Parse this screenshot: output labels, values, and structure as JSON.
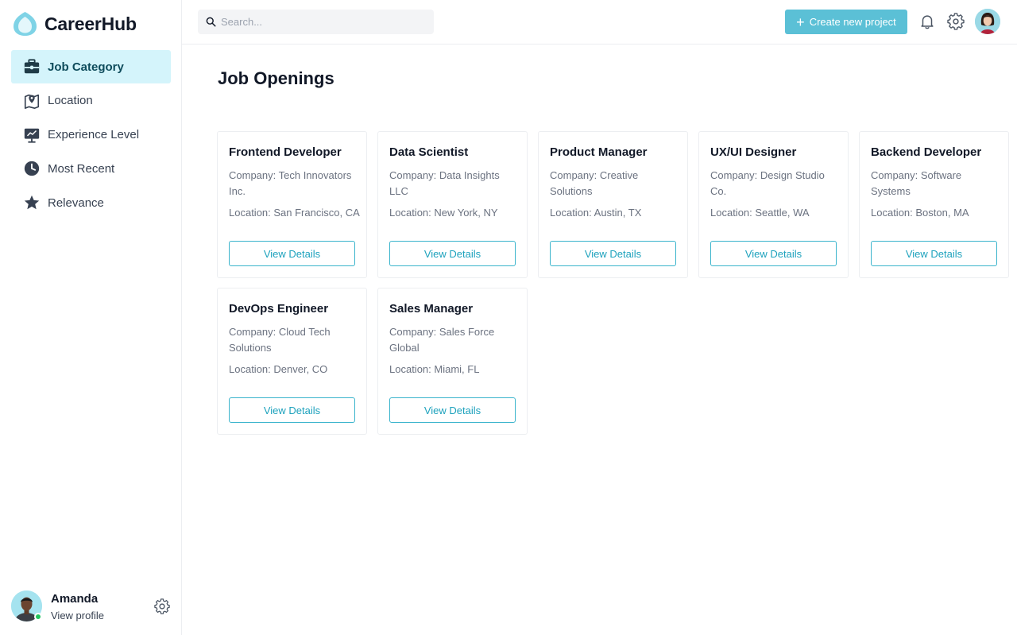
{
  "brand": {
    "name": "CareerHub"
  },
  "sidebar": {
    "items": [
      {
        "label": "Job Category",
        "icon": "briefcase-icon",
        "active": true
      },
      {
        "label": "Location",
        "icon": "map-pin-icon",
        "active": false
      },
      {
        "label": "Experience Level",
        "icon": "presentation-icon",
        "active": false
      },
      {
        "label": "Most Recent",
        "icon": "clock-icon",
        "active": false
      },
      {
        "label": "Relevance",
        "icon": "star-icon",
        "active": false
      }
    ]
  },
  "profile": {
    "name": "Amanda",
    "link": "View profile"
  },
  "search": {
    "placeholder": "Search..."
  },
  "topbar": {
    "create_label": "Create new project"
  },
  "main": {
    "title": "Job Openings"
  },
  "jobs": [
    {
      "title": "Frontend Developer",
      "company": "Company: Tech Innovators Inc.",
      "location": "Location: San Francisco, CA",
      "button": "View Details"
    },
    {
      "title": "Data Scientist",
      "company": "Company: Data Insights LLC",
      "location": "Location: New York, NY",
      "button": "View Details"
    },
    {
      "title": "Product Manager",
      "company": "Company: Creative Solutions",
      "location": "Location: Austin, TX",
      "button": "View Details"
    },
    {
      "title": "UX/UI Designer",
      "company": "Company: Design Studio Co.",
      "location": "Location: Seattle, WA",
      "button": "View Details"
    },
    {
      "title": "Backend Developer",
      "company": "Company: Software Systems",
      "location": "Location: Boston, MA",
      "button": "View Details"
    },
    {
      "title": "DevOps Engineer",
      "company": "Company: Cloud Tech Solutions",
      "location": "Location: Denver, CO",
      "button": "View Details"
    },
    {
      "title": "Sales Manager",
      "company": "Company: Sales Force Global",
      "location": "Location: Miami, FL",
      "button": "View Details"
    }
  ],
  "colors": {
    "accent": "#5bc0d6",
    "active_bg": "#d4f4fb",
    "online": "#22c55e"
  }
}
